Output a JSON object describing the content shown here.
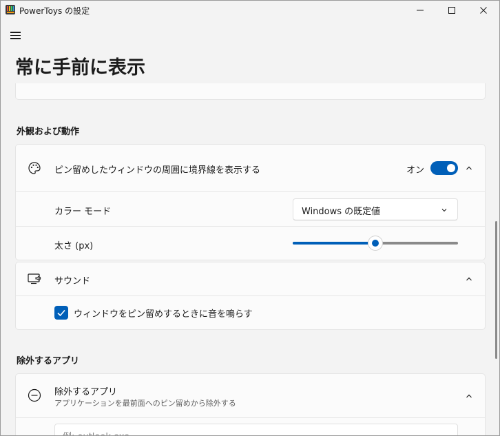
{
  "window": {
    "title": "PowerToys の設定",
    "minimize": "—",
    "maximize": "□",
    "close": "✕"
  },
  "page": {
    "title": "常に手前に表示"
  },
  "sections": {
    "appearance_label": "外観および動作",
    "excluded_label": "除外するアプリ"
  },
  "border_setting": {
    "label": "ピン留めしたウィンドウの周囲に境界線を表示する",
    "state_label": "オン",
    "enabled": true,
    "icon": "palette-icon"
  },
  "color_mode": {
    "label": "カラー モード",
    "selected": "Windows の既定値"
  },
  "thickness": {
    "label": "太さ (px)",
    "value_fraction": 0.5
  },
  "sound": {
    "label": "サウンド",
    "icon": "sound-icon",
    "checkbox_label": "ウィンドウをピン留めするときに音を鳴らす",
    "checked": true
  },
  "excluded_apps": {
    "label": "除外するアプリ",
    "description": "アプリケーションを最前面へのピン留めから除外する",
    "icon": "minus-circle-icon",
    "placeholder": "例: outlook.exe"
  },
  "colors": {
    "accent": "#005fb8",
    "background": "#f3f3f3",
    "card": "#fbfbfb"
  }
}
